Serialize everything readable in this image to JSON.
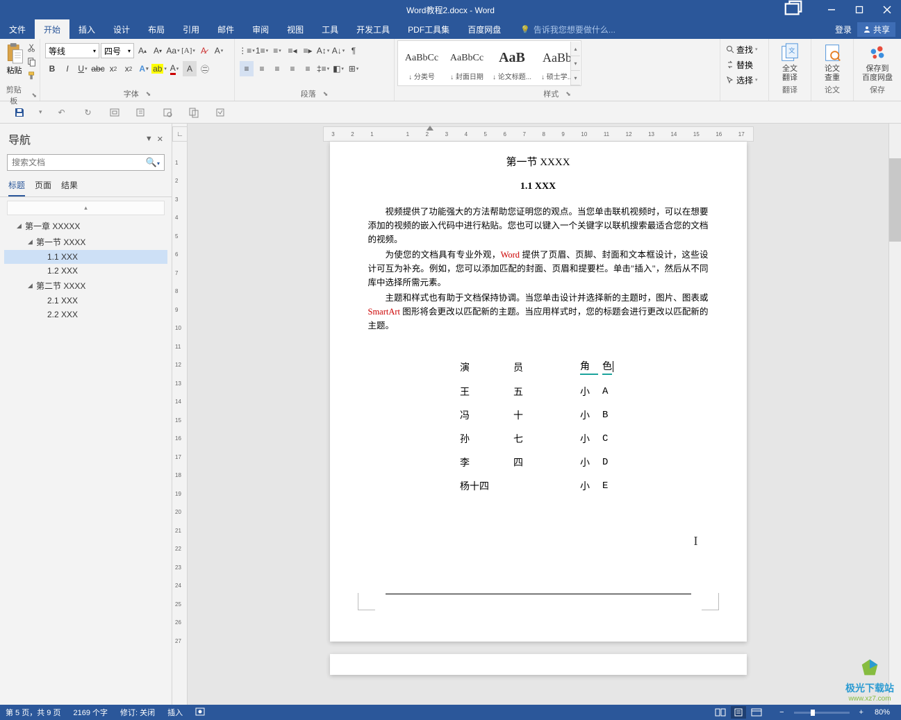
{
  "title_bar": {
    "document_title": "Word教程2.docx - Word"
  },
  "tabs": {
    "file": "文件",
    "home": "开始",
    "insert": "插入",
    "design": "设计",
    "layout": "布局",
    "references": "引用",
    "mailings": "邮件",
    "review": "审阅",
    "view": "视图",
    "tools": "工具",
    "devtools": "开发工具",
    "pdf": "PDF工具集",
    "baidu": "百度网盘",
    "tell_me": "告诉我您想要做什么...",
    "login": "登录",
    "share": "共享"
  },
  "ribbon": {
    "clipboard": {
      "paste": "粘贴",
      "label": "剪贴板"
    },
    "font": {
      "name": "等线",
      "size": "四号",
      "label": "字体"
    },
    "paragraph": {
      "label": "段落"
    },
    "styles": {
      "label": "样式",
      "items": [
        {
          "preview": "AaBbCc",
          "name": "↓ 分类号"
        },
        {
          "preview": "AaBbCc",
          "name": "↓ 封面日期"
        },
        {
          "preview": "AaB",
          "name": "↓ 论文标题..."
        },
        {
          "preview": "AaBb",
          "name": "↓ 硕士学..."
        }
      ]
    },
    "editing": {
      "find": "查找",
      "replace": "替换",
      "select": "选择"
    },
    "translate": {
      "line1": "全文",
      "line2": "翻译",
      "group": "翻译"
    },
    "thesis": {
      "line1": "论文",
      "line2": "查重",
      "group": "论文"
    },
    "save_cloud": {
      "line1": "保存到",
      "line2": "百度网盘",
      "group": "保存"
    }
  },
  "navigation": {
    "title": "导航",
    "search_placeholder": "搜索文档",
    "tabs": {
      "headings": "标题",
      "pages": "页面",
      "results": "结果"
    },
    "tree": [
      {
        "level": 1,
        "label": "第一章 XXXXX",
        "expanded": true
      },
      {
        "level": 2,
        "label": "第一节 XXXX",
        "expanded": true
      },
      {
        "level": 3,
        "label": "1.1 XXX",
        "selected": true
      },
      {
        "level": 3,
        "label": "1.2 XXX"
      },
      {
        "level": 2,
        "label": "第二节 XXXX",
        "expanded": true
      },
      {
        "level": 3,
        "label": "2.1 XXX"
      },
      {
        "level": 3,
        "label": "2.2 XXX"
      }
    ]
  },
  "document": {
    "section_title": "第一节  XXXX",
    "sub_title": "1.1 XXX",
    "para1": "视频提供了功能强大的方法帮助您证明您的观点。当您单击联机视频时，可以在想要添加的视频的嵌入代码中进行粘贴。您也可以键入一个关键字以联机搜索最适合您的文档的视频。",
    "para2_a": "为使您的文档具有专业外观，",
    "para2_word": "Word",
    "para2_b": " 提供了页眉、页脚、封面和文本框设计，这些设计可互为补充。例如，您可以添加匹配的封面、页眉和提要栏。单击\"插入\"，然后从不同库中选择所需元素。",
    "para3_a": "主题和样式也有助于文档保持协调。当您单击设计并选择新的主题时，图片、图表或 ",
    "para3_smartart": "SmartArt",
    "para3_b": " 图形将会更改以匹配新的主题。当应用样式时，您的标题会进行更改以匹配新的主题。",
    "table": {
      "header": {
        "c1": "演",
        "c1b": "员",
        "c2": "角",
        "c2b": "色"
      },
      "rows": [
        {
          "a": "王",
          "b": "五",
          "c": "小",
          "d": "A"
        },
        {
          "a": "冯",
          "b": "十",
          "c": "小",
          "d": "B"
        },
        {
          "a": "孙",
          "b": "七",
          "c": "小",
          "d": "C"
        },
        {
          "a": "李",
          "b": "四",
          "c": "小",
          "d": "D"
        },
        {
          "a": "杨十四",
          "b": "",
          "c": "小",
          "d": "E"
        }
      ]
    }
  },
  "status": {
    "page": "第 5 页，共 9 页",
    "words": "2169 个字",
    "track": "修订: 关闭",
    "insert": "插入",
    "zoom": "80%"
  },
  "watermark": {
    "name": "极光下载站",
    "url": "www.xz7.com"
  }
}
